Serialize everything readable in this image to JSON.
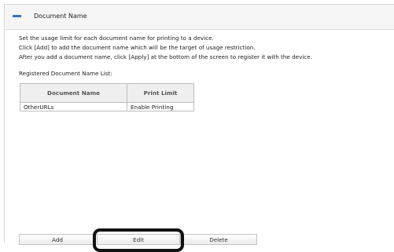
{
  "header": {
    "title": "Document Name",
    "icon": "document-name-icon"
  },
  "instructions": [
    "Set the usage limit for each document name for printing to a device.",
    "Click [Add] to add the document name which will be the target of usage restriction.",
    "After you add a document name, click [Apply] at the bottom of the screen to register it with the device."
  ],
  "list_label": "Registered Document Name List:",
  "table": {
    "columns": [
      "Document Name",
      "Print Limit"
    ],
    "rows": [
      {
        "document_name": "OtherURLs",
        "print_limit": "Enable Printing"
      }
    ]
  },
  "buttons": {
    "add": "Add",
    "edit": "Edit",
    "delete": "Delete"
  },
  "colors": {
    "accent": "#3d6fb6",
    "highlight_border": "#111111"
  }
}
